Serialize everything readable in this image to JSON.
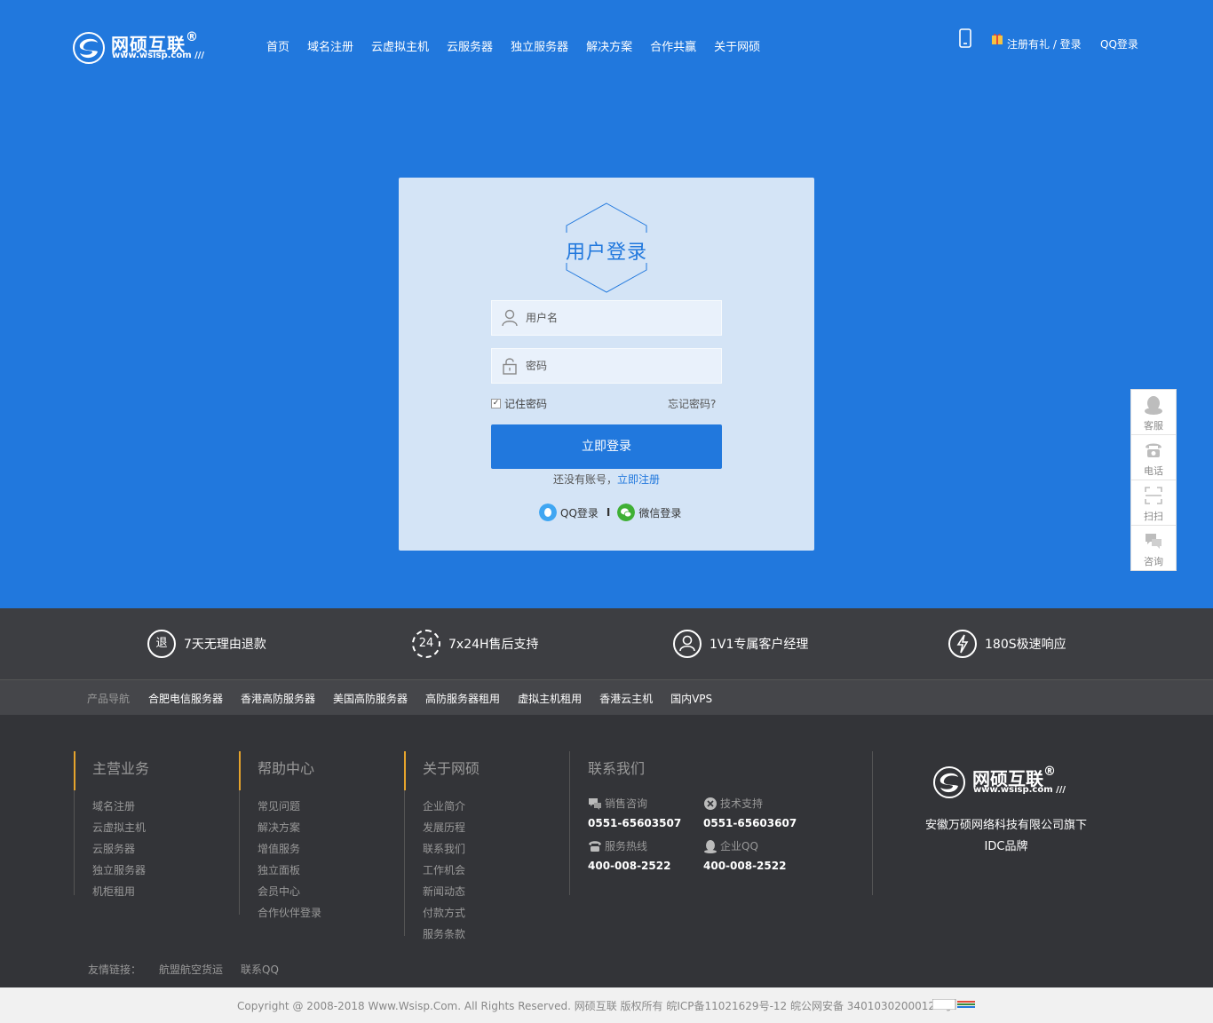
{
  "header": {
    "logo_name": "网硕互联",
    "logo_reg": "®",
    "logo_url": "www.wsisp.com",
    "nav": [
      "首页",
      "域名注册",
      "云虚拟主机",
      "云服务器",
      "独立服务器",
      "解决方案",
      "合作共赢",
      "关于网硕"
    ],
    "register_login": "注册有礼 / 登录",
    "qq_login": "QQ登录"
  },
  "login": {
    "title": "用户登录",
    "username_placeholder": "用户名",
    "password_placeholder": "密码",
    "remember_label": "记住密码",
    "remember_checked": true,
    "forgot_label": "忘记密码?",
    "submit_label": "立即登录",
    "no_account_text": "还没有账号，",
    "register_link": "立即注册",
    "qq_label": "QQ登录",
    "separator": "I",
    "wechat_label": "微信登录"
  },
  "floatbar": [
    "客服",
    "电话",
    "扫扫",
    "咨询"
  ],
  "features": [
    {
      "badge": "退",
      "label": "7天无理由退款"
    },
    {
      "badge": "24",
      "label": "7x24H售后支持"
    },
    {
      "badge": "",
      "label": "1V1专属客户经理"
    },
    {
      "badge": "",
      "label": "180S极速响应"
    }
  ],
  "product_nav": {
    "label": "产品导航",
    "links": [
      "合肥电信服务器",
      "香港高防服务器",
      "美国高防服务器",
      "高防服务器租用",
      "虚拟主机租用",
      "香港云主机",
      "国内VPS"
    ]
  },
  "footer": {
    "col1": {
      "title": "主营业务",
      "items": [
        "域名注册",
        "云虚拟主机",
        "云服务器",
        "独立服务器",
        "机柜租用"
      ]
    },
    "col2": {
      "title": "帮助中心",
      "items": [
        "常见问题",
        "解决方案",
        "增值服务",
        "独立面板",
        "会员中心",
        "合作伙伴登录"
      ]
    },
    "col3": {
      "title": "关于网硕",
      "items": [
        "企业简介",
        "发展历程",
        "联系我们",
        "工作机会",
        "新闻动态",
        "付款方式",
        "服务条款"
      ]
    },
    "contact": {
      "title": "联系我们",
      "sales_label": "销售咨询",
      "sales_number": "0551-65603507",
      "tech_label": "技术支持",
      "tech_number": "0551-65603607",
      "hotline_label": "服务热线",
      "hotline_number": "400-008-2522",
      "qq_label": "企业QQ",
      "qq_number": "400-008-2522"
    },
    "company_line1": "安徽万硕网络科技有限公司旗下",
    "company_line2": "IDC品牌",
    "friends_label": "友情链接：",
    "friends": [
      "航盟航空货运",
      "联系QQ"
    ]
  },
  "copyright": "Copyright @ 2008-2018 Www.Wsisp.Com. All Rights Reserved. 网硕互联 版权所有 皖ICP备11021629号-12 皖公网安备 34010302000122号",
  "colors": {
    "primary": "#2178dd",
    "card": "#d4e4f6",
    "dark": "#333438",
    "accent": "#e6a42c"
  }
}
